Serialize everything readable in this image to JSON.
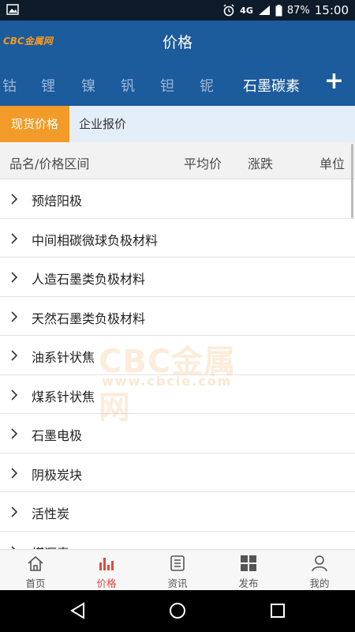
{
  "status_bar": {
    "network": "4G",
    "battery": "87%",
    "time": "15:00"
  },
  "header": {
    "logo": "CBC金属网",
    "title": "价格"
  },
  "metal_tabs": {
    "items": [
      "钴",
      "锂",
      "镍",
      "钒",
      "钽",
      "铌",
      "石墨碳素"
    ],
    "active": "石墨碳素",
    "add_label": "+"
  },
  "sub_tabs": {
    "spot": "现货价格",
    "company": "企业报价"
  },
  "columns": {
    "name": "品名/价格区间",
    "avg": "平均价",
    "change": "涨跌",
    "unit": "单位"
  },
  "products": [
    "预焙阳极",
    "中间相碳微球负极材料",
    "人造石墨类负极材料",
    "天然石墨类负极材料",
    "油系针状焦",
    "煤系针状焦",
    "石墨电极",
    "阴极炭块",
    "活性炭",
    "煤沥青"
  ],
  "watermark": {
    "brand": "CBC金属网",
    "url": "www.cbcie.com"
  },
  "bottom_nav": {
    "home": "首页",
    "price": "价格",
    "news": "资讯",
    "publish": "发布",
    "mine": "我的"
  },
  "colors": {
    "header_blue": "#1c5b9c",
    "accent_orange": "#f29b28",
    "active_red": "#e04a3c"
  }
}
